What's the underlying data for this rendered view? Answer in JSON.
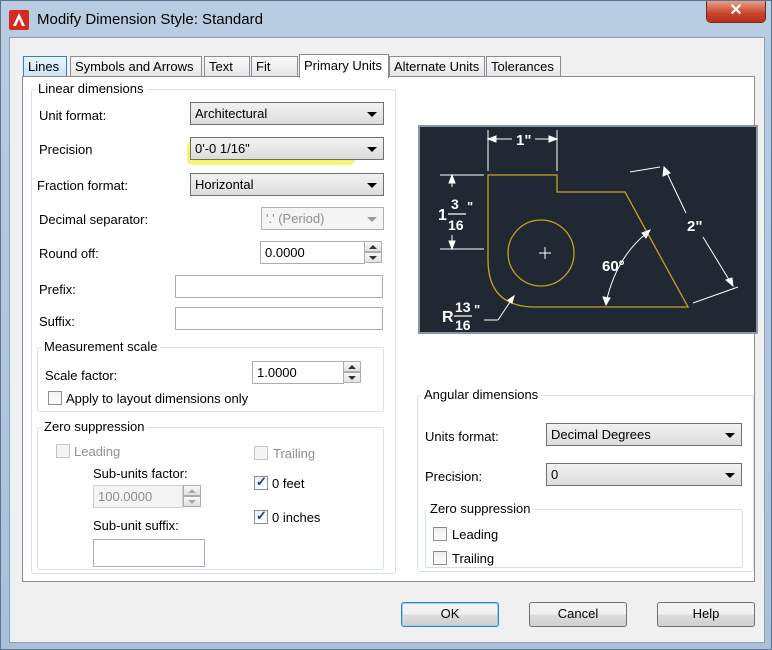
{
  "window": {
    "title": "Modify Dimension Style: Standard",
    "close_glyph": "✕"
  },
  "tabs": [
    {
      "label": "Lines"
    },
    {
      "label": "Symbols and Arrows"
    },
    {
      "label": "Text"
    },
    {
      "label": "Fit"
    },
    {
      "label": "Primary Units"
    },
    {
      "label": "Alternate Units"
    },
    {
      "label": "Tolerances"
    }
  ],
  "active_tab": "Primary Units",
  "linear": {
    "title": "Linear dimensions",
    "unit_format_label": "Unit format:",
    "unit_format_value": "Architectural",
    "precision_label": "Precision",
    "precision_value": "0'-0 1/16\"",
    "fraction_format_label": "Fraction format:",
    "fraction_format_value": "Horizontal",
    "decimal_separator_label": "Decimal separator:",
    "decimal_separator_value": "'.' (Period)",
    "round_off_label": "Round off:",
    "round_off_value": "0.0000",
    "prefix_label": "Prefix:",
    "prefix_value": "",
    "suffix_label": "Suffix:",
    "suffix_value": ""
  },
  "measurement_scale": {
    "title": "Measurement scale",
    "scale_factor_label": "Scale factor:",
    "scale_factor_value": "1.0000",
    "apply_layout_label": "Apply to layout dimensions only",
    "apply_layout_checked": false
  },
  "zero_suppression": {
    "title": "Zero suppression",
    "leading_label": "Leading",
    "trailing_label": "Trailing",
    "sub_units_factor_label": "Sub-units factor:",
    "sub_units_factor_value": "100.0000",
    "sub_unit_suffix_label": "Sub-unit suffix:",
    "sub_unit_suffix_value": "",
    "zero_feet_label": "0 feet",
    "zero_feet_checked": true,
    "zero_inches_label": "0 inches",
    "zero_inches_checked": true
  },
  "preview": {
    "dim_top": "1\"",
    "dim_left_whole": "1",
    "dim_left_num": "3",
    "dim_left_den": "16",
    "dim_left_inch": "\"",
    "dim_right": "2\"",
    "dim_angle": "60°",
    "dim_radius_prefix": "R",
    "dim_radius_num": "13",
    "dim_radius_den": "16",
    "dim_radius_inch": "\"",
    "line_color": "#c8a020",
    "text_color": "#ffffff",
    "background": "#202833"
  },
  "angular": {
    "title": "Angular dimensions",
    "units_format_label": "Units format:",
    "units_format_value": "Decimal Degrees",
    "precision_label": "Precision:",
    "precision_value": "0",
    "zero_title": "Zero suppression",
    "leading_label": "Leading",
    "trailing_label": "Trailing"
  },
  "buttons": {
    "ok": "OK",
    "cancel": "Cancel",
    "help": "Help"
  },
  "colors": {
    "highlight": "#f3f35a",
    "close": "#c8412a"
  }
}
